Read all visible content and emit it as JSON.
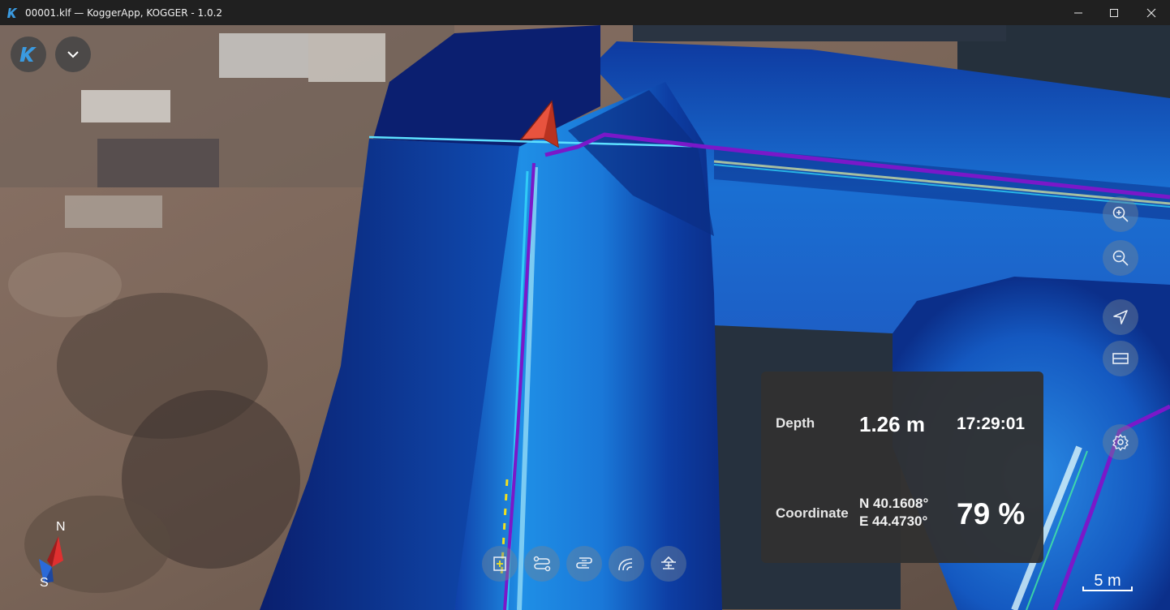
{
  "window": {
    "title": "00001.klf — KoggerApp, KOGGER - 1.0.2"
  },
  "colors": {
    "accent": "#3a8fd6",
    "track": "#7a18c9",
    "panel_bg": "#303030"
  },
  "toolbar_top": {
    "logo_icon": "kogger-logo-icon",
    "menu_icon": "chevron-down-icon"
  },
  "side_buttons": [
    {
      "name": "zoom-in-icon"
    },
    {
      "name": "zoom-out-icon"
    },
    {
      "name": "navigate-icon"
    },
    {
      "name": "ruler-icon"
    },
    {
      "name": "settings-icon"
    }
  ],
  "bottom_buttons": [
    {
      "name": "add-marker-icon"
    },
    {
      "name": "track-icon"
    },
    {
      "name": "route-icon"
    },
    {
      "name": "sonar-icon"
    },
    {
      "name": "boat-icon"
    }
  ],
  "info": {
    "depth_label": "Depth",
    "depth_value": "1.26 m",
    "time_value": "17:29:01",
    "coord_label": "Coordinate",
    "coord_n": "N 40.1608°",
    "coord_e": "E 44.4730°",
    "percent": "79 %"
  },
  "compass": {
    "north": "N",
    "south": "S"
  },
  "scale": {
    "label": "5 m"
  }
}
